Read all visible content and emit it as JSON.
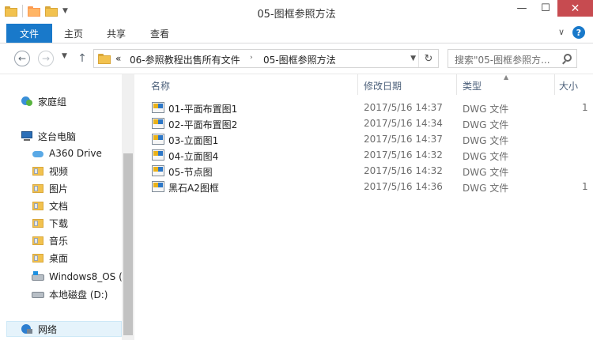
{
  "window": {
    "title": "05-图框参照方法",
    "minimize": "—",
    "maximize": "☐",
    "close": "✕"
  },
  "ribbon": {
    "file_tab": "文件",
    "tabs": [
      "主页",
      "共享",
      "查看"
    ],
    "expand_chevron": "∨",
    "help": "?"
  },
  "nav": {
    "back": "←",
    "forward": "→",
    "up": "↑",
    "breadcrumb_overflow": "«",
    "breadcrumbs": [
      "06-参照教程出售所有文件",
      "05-图框参照方法"
    ],
    "search_placeholder": "搜索\"05-图框参照方...",
    "refresh": "↻"
  },
  "sidebar": {
    "items": [
      {
        "label": "家庭组",
        "icon": "homegroup-icon",
        "level": 0
      },
      {
        "label": "这台电脑",
        "icon": "computer-icon",
        "level": 0
      },
      {
        "label": "A360 Drive",
        "icon": "cloud-drive-icon",
        "level": 1
      },
      {
        "label": "视频",
        "icon": "videos-folder-icon",
        "level": 1
      },
      {
        "label": "图片",
        "icon": "pictures-folder-icon",
        "level": 1
      },
      {
        "label": "文档",
        "icon": "documents-folder-icon",
        "level": 1
      },
      {
        "label": "下载",
        "icon": "downloads-folder-icon",
        "level": 1
      },
      {
        "label": "音乐",
        "icon": "music-folder-icon",
        "level": 1
      },
      {
        "label": "桌面",
        "icon": "desktop-folder-icon",
        "level": 1
      },
      {
        "label": "Windows8_OS (",
        "icon": "windows-drive-icon",
        "level": 1
      },
      {
        "label": "本地磁盘 (D:)",
        "icon": "local-disk-icon",
        "level": 1
      },
      {
        "label": "网络",
        "icon": "network-icon",
        "level": 0
      }
    ]
  },
  "columns": {
    "name": "名称",
    "modified": "修改日期",
    "type": "类型",
    "size": "大小"
  },
  "files": [
    {
      "name": "01-平面布置图1",
      "modified": "2017/5/16 14:37",
      "type": "DWG 文件",
      "size": "1"
    },
    {
      "name": "02-平面布置图2",
      "modified": "2017/5/16 14:34",
      "type": "DWG 文件",
      "size": ""
    },
    {
      "name": "03-立面图1",
      "modified": "2017/5/16 14:37",
      "type": "DWG 文件",
      "size": ""
    },
    {
      "name": "04-立面图4",
      "modified": "2017/5/16 14:32",
      "type": "DWG 文件",
      "size": ""
    },
    {
      "name": "05-节点图",
      "modified": "2017/5/16 14:32",
      "type": "DWG 文件",
      "size": ""
    },
    {
      "name": "黑石A2图框",
      "modified": "2017/5/16 14:36",
      "type": "DWG 文件",
      "size": "1"
    }
  ],
  "colors": {
    "accent": "#1979ca",
    "close_button": "#c74b50",
    "selection": "#e5f3fb"
  }
}
